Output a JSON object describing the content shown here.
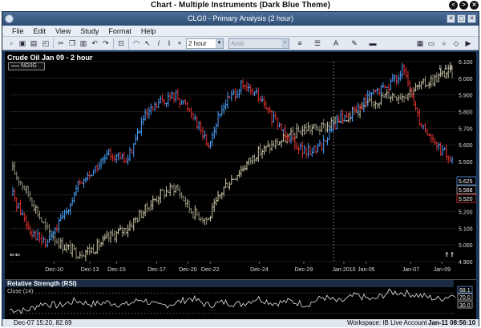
{
  "outer": {
    "title": "Chart - Multiple Instruments (Dark Blue Theme)",
    "buttons": [
      "<",
      ">",
      "✕"
    ]
  },
  "window": {
    "title": "CLG0 - Primary Analysis (2 hour)",
    "buttons": [
      "✕",
      "▢",
      "✕"
    ]
  },
  "menu": [
    "File",
    "Edit",
    "View",
    "Study",
    "Format",
    "Help"
  ],
  "toolbar": {
    "interval": "2 hour",
    "font": "Arial"
  },
  "chart": {
    "title": "Crude Oil Jan 09 - 2 hour",
    "legend_series": "NG0G",
    "price_labels": [
      {
        "text": "5.625",
        "color": "#ffffff",
        "border": "#4a7cc0"
      },
      {
        "text": "5.568",
        "color": "#ffffff",
        "border": "#8a8a8a"
      },
      {
        "text": "5.520",
        "color": "#ffffff",
        "border": "#c03030"
      }
    ]
  },
  "chart_data": {
    "type": "candlestick",
    "title": "Crude Oil Jan 09 - 2 hour",
    "xlabel": "",
    "ylabel": "",
    "ylim": [
      4.9,
      6.1
    ],
    "y_ticks": [
      6.1,
      6.0,
      5.9,
      5.8,
      5.7,
      5.6,
      5.5,
      5.4,
      5.3,
      5.2,
      5.1,
      5.0,
      4.9
    ],
    "y_tick_labels": [
      "6.100",
      "6.000",
      "5.900",
      "5.800",
      "5.700",
      "5.600",
      "5.500",
      "5.400",
      "5.300",
      "5.200",
      "5.100",
      "5.000",
      "4.900"
    ],
    "x_tick_labels": [
      "Dec-10",
      "Dec-13",
      "Dec-15",
      "Dec-17",
      "Dec-20",
      "Dec-22",
      "Dec-24",
      "Dec-29",
      "Jan-2010",
      "Jan-05",
      "Jan-07",
      "Jan-09"
    ],
    "x_tick_positions": [
      0.1,
      0.18,
      0.24,
      0.33,
      0.4,
      0.45,
      0.56,
      0.66,
      0.75,
      0.8,
      0.9,
      0.97
    ],
    "series": [
      {
        "name": "CLG0",
        "style": "ohlc-red-blue",
        "values": [
          5.3,
          5.1,
          5.0,
          5.15,
          5.35,
          5.45,
          5.55,
          5.5,
          5.75,
          5.85,
          5.9,
          5.8,
          5.6,
          5.85,
          5.95,
          5.9,
          5.75,
          5.65,
          5.55,
          5.6,
          5.75,
          5.8,
          5.9,
          5.95,
          6.05,
          5.75,
          5.6,
          5.5
        ],
        "up_color": "#4aa3ff",
        "down_color": "#e03030"
      },
      {
        "name": "NG0G",
        "style": "ohlc-grey",
        "values": [
          5.45,
          5.3,
          5.1,
          5.0,
          4.95,
          4.98,
          5.05,
          5.1,
          5.2,
          5.3,
          5.35,
          5.2,
          5.15,
          5.35,
          5.45,
          5.55,
          5.6,
          5.65,
          5.7,
          5.7,
          5.75,
          5.8,
          5.85,
          5.9,
          5.9,
          5.95,
          6.0,
          6.05
        ],
        "up_color": "#cfc9a8",
        "down_color": "#8d8a77"
      }
    ],
    "grid": true
  },
  "rsi": {
    "title": "Relative Strength (RSI)",
    "subtitle": "Close (14)",
    "levels": [
      "68.1",
      "70.0",
      "30.0"
    ],
    "values": [
      38,
      35,
      50,
      45,
      55,
      48,
      52,
      46,
      58,
      44,
      50,
      60,
      46,
      52,
      48,
      60,
      50,
      54,
      47,
      62,
      52,
      66,
      56,
      72,
      70,
      64,
      58,
      68
    ]
  },
  "status": {
    "left": "Dec-07 15:20, 82.69",
    "workspace": "Workspace: IB Live Account",
    "time": "Jan-11 08:56:10"
  },
  "colors": {
    "frame": "#1f3a5f",
    "chart_bg": "#000000",
    "up": "#4aa3ff",
    "down": "#e03030",
    "secondary": "#cfc9a8"
  }
}
